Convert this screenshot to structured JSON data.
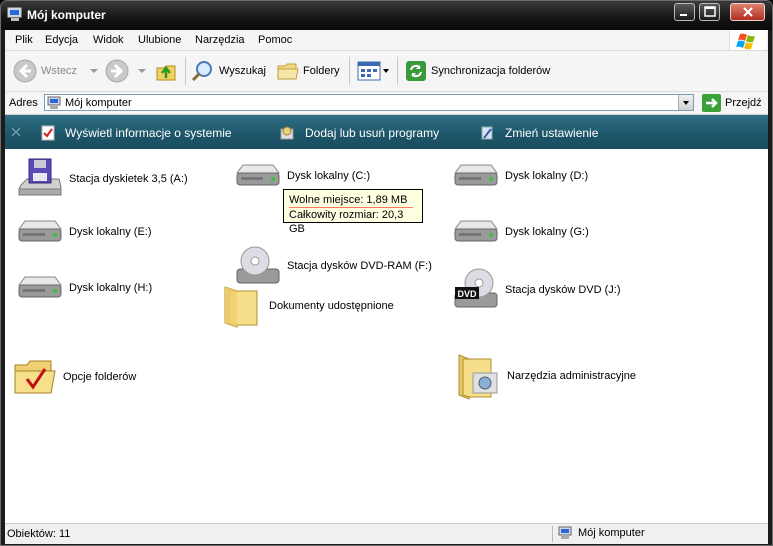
{
  "window": {
    "title": "Mój komputer",
    "icon": "my-computer-icon"
  },
  "menu": [
    "Plik",
    "Edycja",
    "Widok",
    "Ulubione",
    "Narzędzia",
    "Pomoc"
  ],
  "toolbar": {
    "back": "Wstecz",
    "search": "Wyszukaj",
    "folders": "Foldery",
    "sync": "Synchronizacja folderów"
  },
  "address": {
    "label": "Adres",
    "value": "Mój komputer",
    "go": "Przejdź"
  },
  "tasks": [
    {
      "label": "Wyświetl informacje o systemie",
      "icon": "system-info-icon"
    },
    {
      "label": "Dodaj lub usuń programy",
      "icon": "add-remove-programs-icon"
    },
    {
      "label": "Zmień ustawienie",
      "icon": "change-setting-icon"
    }
  ],
  "items": [
    {
      "label": "Stacja dyskietek 3,5 (A:)",
      "icon": "floppy-drive-icon"
    },
    {
      "label": "Dysk lokalny (C:)",
      "icon": "hard-drive-icon"
    },
    {
      "label": "Dysk lokalny (D:)",
      "icon": "hard-drive-icon"
    },
    {
      "label": "Dysk lokalny (E:)",
      "icon": "hard-drive-icon"
    },
    {
      "label": "Stacja dysków DVD-RAM (F:)",
      "icon": "dvd-ram-drive-icon"
    },
    {
      "label": "Dysk lokalny (G:)",
      "icon": "hard-drive-icon"
    },
    {
      "label": "Dysk lokalny (H:)",
      "icon": "hard-drive-icon"
    },
    {
      "label": "Dokumenty udostępnione",
      "icon": "shared-folder-icon"
    },
    {
      "label": "Stacja dysków DVD (J:)",
      "icon": "dvd-drive-icon"
    },
    {
      "label": "Opcje folderów",
      "icon": "folder-options-icon"
    },
    {
      "label": "Narzędzia administracyjne",
      "icon": "admin-tools-icon"
    }
  ],
  "tooltip": {
    "free": "Wolne miejsce: 1,89 MB",
    "total": "Całkowity rozmiar: 20,3 GB"
  },
  "status": {
    "count": "Obiektów: 11",
    "location": "Mój komputer"
  },
  "colors": {
    "titlebar": "#141414",
    "tasksbar": "#1d5568",
    "tooltip": "#ffffe1"
  }
}
